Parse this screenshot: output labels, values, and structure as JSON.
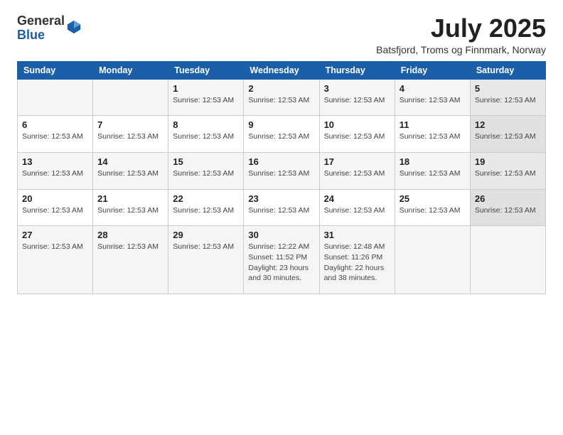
{
  "logo": {
    "general": "General",
    "blue": "Blue"
  },
  "header": {
    "month_year": "July 2025",
    "location": "Batsfjord, Troms og Finnmark, Norway"
  },
  "weekdays": [
    "Sunday",
    "Monday",
    "Tuesday",
    "Wednesday",
    "Thursday",
    "Friday",
    "Saturday"
  ],
  "weeks": [
    [
      {
        "day": "",
        "info": ""
      },
      {
        "day": "",
        "info": ""
      },
      {
        "day": "1",
        "info": "Sunrise: 12:53 AM"
      },
      {
        "day": "2",
        "info": "Sunrise: 12:53 AM"
      },
      {
        "day": "3",
        "info": "Sunrise: 12:53 AM"
      },
      {
        "day": "4",
        "info": "Sunrise: 12:53 AM"
      },
      {
        "day": "5",
        "info": "Sunrise: 12:53 AM"
      }
    ],
    [
      {
        "day": "6",
        "info": "Sunrise: 12:53 AM"
      },
      {
        "day": "7",
        "info": "Sunrise: 12:53 AM"
      },
      {
        "day": "8",
        "info": "Sunrise: 12:53 AM"
      },
      {
        "day": "9",
        "info": "Sunrise: 12:53 AM"
      },
      {
        "day": "10",
        "info": "Sunrise: 12:53 AM"
      },
      {
        "day": "11",
        "info": "Sunrise: 12:53 AM"
      },
      {
        "day": "12",
        "info": "Sunrise: 12:53 AM"
      }
    ],
    [
      {
        "day": "13",
        "info": "Sunrise: 12:53 AM"
      },
      {
        "day": "14",
        "info": "Sunrise: 12:53 AM"
      },
      {
        "day": "15",
        "info": "Sunrise: 12:53 AM"
      },
      {
        "day": "16",
        "info": "Sunrise: 12:53 AM"
      },
      {
        "day": "17",
        "info": "Sunrise: 12:53 AM"
      },
      {
        "day": "18",
        "info": "Sunrise: 12:53 AM"
      },
      {
        "day": "19",
        "info": "Sunrise: 12:53 AM"
      }
    ],
    [
      {
        "day": "20",
        "info": "Sunrise: 12:53 AM"
      },
      {
        "day": "21",
        "info": "Sunrise: 12:53 AM"
      },
      {
        "day": "22",
        "info": "Sunrise: 12:53 AM"
      },
      {
        "day": "23",
        "info": "Sunrise: 12:53 AM"
      },
      {
        "day": "24",
        "info": "Sunrise: 12:53 AM"
      },
      {
        "day": "25",
        "info": "Sunrise: 12:53 AM"
      },
      {
        "day": "26",
        "info": "Sunrise: 12:53 AM"
      }
    ],
    [
      {
        "day": "27",
        "info": "Sunrise: 12:53 AM"
      },
      {
        "day": "28",
        "info": "Sunrise: 12:53 AM"
      },
      {
        "day": "29",
        "info": "Sunrise: 12:53 AM"
      },
      {
        "day": "30",
        "info": "Sunrise: 12:22 AM\nSunset: 11:52 PM\nDaylight: 23 hours and 30 minutes."
      },
      {
        "day": "31",
        "info": "Sunrise: 12:48 AM\nSunset: 11:26 PM\nDaylight: 22 hours and 38 minutes."
      },
      {
        "day": "",
        "info": ""
      },
      {
        "day": "",
        "info": ""
      }
    ]
  ]
}
